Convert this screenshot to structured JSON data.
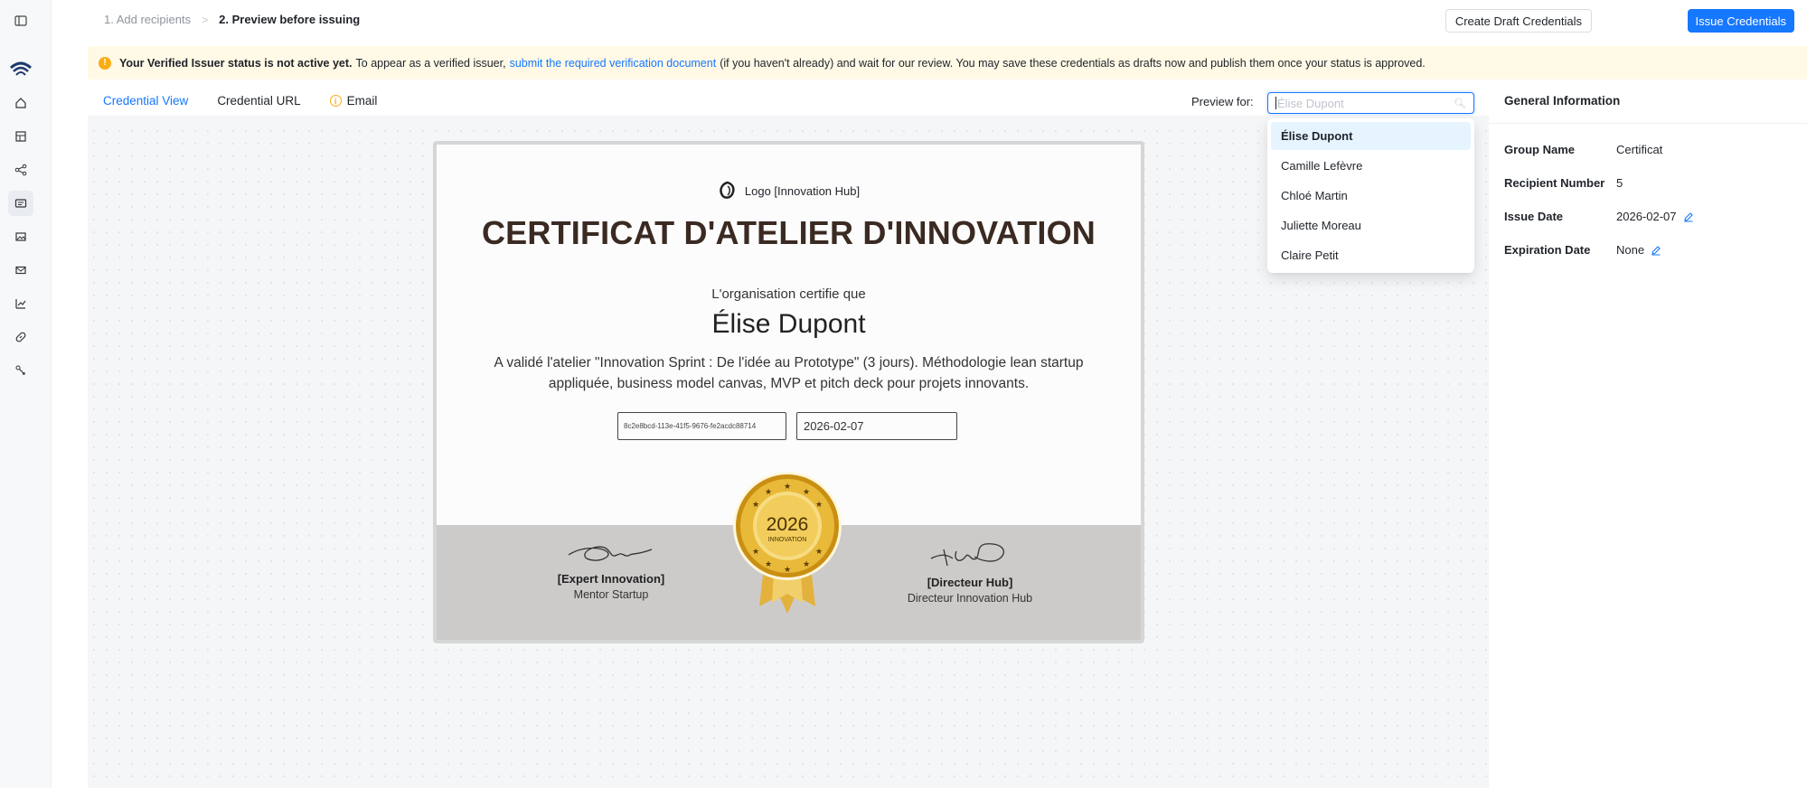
{
  "steps": {
    "step1": "1. Add recipients",
    "separator": ">",
    "step2": "2. Preview before issuing"
  },
  "toolbar": {
    "draft_label": "Create Draft Credentials",
    "issue_label": "Issue Credentials"
  },
  "banner": {
    "bold": "Your Verified Issuer status is not active yet.",
    "text1": "To appear as a verified issuer,",
    "link": "submit the required verification document",
    "text2": "(if you haven't already) and wait for our review. You may save these credentials as drafts now and publish them once your status is approved."
  },
  "tabs": [
    {
      "label": "Credential View"
    },
    {
      "label": "Credential URL"
    },
    {
      "label": "Email"
    }
  ],
  "preview": {
    "label": "Preview for:",
    "placeholder": "Élise Dupont",
    "options": [
      "Élise Dupont",
      "Camille Lefèvre",
      "Chloé Martin",
      "Juliette Moreau",
      "Claire Petit"
    ],
    "selected": "Élise Dupont"
  },
  "certificate": {
    "logo_text": "Logo [Innovation Hub]",
    "title": "CERTIFICAT D'ATELIER D'INNOVATION",
    "certifie": "L'organisation certifie que",
    "recipient": "Élise Dupont",
    "description": "A validé l'atelier \"Innovation Sprint : De l'idée au Prototype\" (3 jours). Méthodologie lean startup appliquée, business model canvas, MVP et pitch deck pour projets innovants.",
    "credential_id": "8c2e8bcd-113e-41f5-9676-fe2acdc88714",
    "date": "2026-02-07",
    "seal_year": "2026",
    "seal_text": "INNOVATION",
    "signer_left_role": "[Expert Innovation]",
    "signer_left_title": "Mentor Startup",
    "signer_right_role": "[Directeur Hub]",
    "signer_right_title": "Directeur Innovation Hub"
  },
  "panel": {
    "title": "General Information",
    "rows": [
      {
        "key": "Group Name",
        "value": "Certificat"
      },
      {
        "key": "Recipient Number",
        "value": "5"
      },
      {
        "key": "Issue Date",
        "value": "2026-02-07"
      },
      {
        "key": "Expiration Date",
        "value": "None"
      }
    ]
  },
  "colors": {
    "accent": "#1677ff",
    "warning": "#faad14",
    "banner_bg": "#fff9e6"
  }
}
